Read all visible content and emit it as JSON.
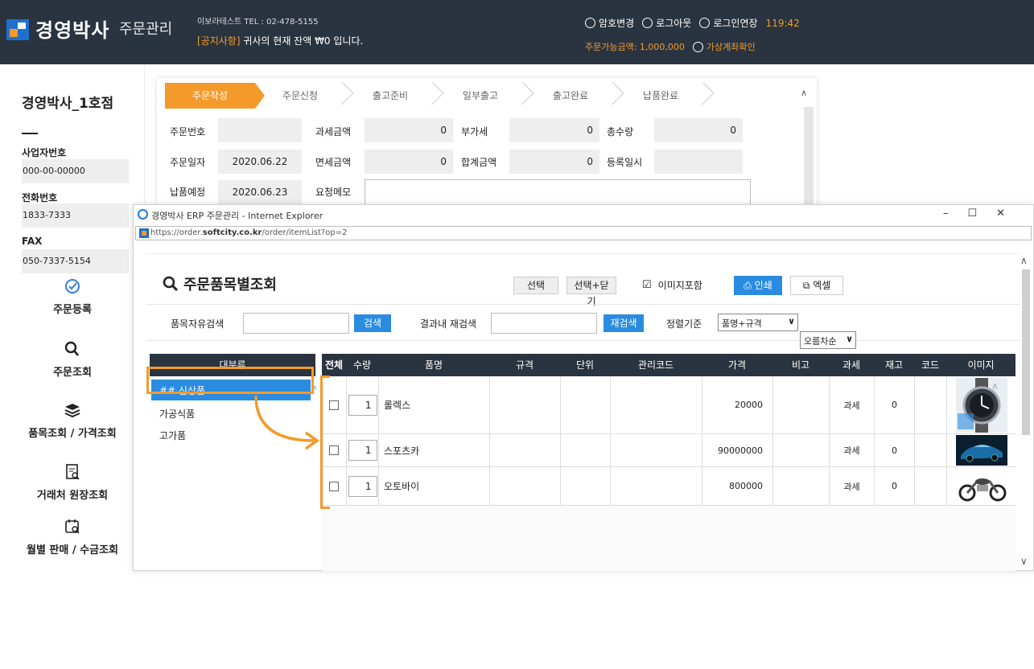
{
  "header": {
    "logo_text": "경영박사",
    "logo_sub": "주문관리",
    "company_info": "이보라테스트 TEL : 02-478-5155",
    "notice_tag": "[공지사항]",
    "notice_text": " 귀사의 현재 잔액 ₩0 입니다.",
    "password_change": "암호변경",
    "logout": "로그아웃",
    "extend_login": "로그인연장",
    "timer": "119:42",
    "order_limit": "주문가능금액: 1,000,000",
    "virtual_account": "가상계좌확인"
  },
  "sidebar": {
    "store_name": "경영박사_1호점",
    "biz_label": "사업자번호",
    "biz_value": "000-00-00000",
    "phone_label": "전화번호",
    "phone_value": "1833-7333",
    "fax_label": "FAX",
    "fax_value": "050-7337-5154",
    "menu": [
      {
        "label": "주문등록",
        "icon": "check-circle-icon"
      },
      {
        "label": "주문조회",
        "icon": "search-icon"
      },
      {
        "label": "품목조회 / 가격조회",
        "icon": "layers-icon"
      },
      {
        "label": "거래처 원장조회",
        "icon": "ledger-search-icon"
      },
      {
        "label": "월별 판매 / 수금조회",
        "icon": "calendar-search-icon"
      }
    ]
  },
  "order_form": {
    "steps": [
      "주문작성",
      "주문신청",
      "출고준비",
      "일부출고",
      "출고완료",
      "납품완료"
    ],
    "order_no_label": "주문번호",
    "order_no_value": "",
    "taxable_label": "과세금액",
    "taxable_value": "0",
    "vat_label": "부가세",
    "vat_value": "0",
    "total_qty_label": "총수량",
    "total_qty_value": "0",
    "order_date_label": "주문일자",
    "order_date_value": "2020.06.22",
    "taxfree_label": "면세금액",
    "taxfree_value": "0",
    "sum_label": "합계금액",
    "sum_value": "0",
    "reg_date_label": "등록일시",
    "reg_date_value": "",
    "delivery_label": "납품예정",
    "delivery_value": "2020.06.23",
    "memo_label": "요청메모"
  },
  "popup": {
    "window_title": "경영박사 ERP 주문관리 - Internet Explorer",
    "url_prefix": "https://order.",
    "url_domain": "softcity.co.kr",
    "url_path": "/order/itemList?op=2",
    "title": "주문품목별조회",
    "btn_select": "선택",
    "btn_select_close": "선택+닫기",
    "include_image": "이미지포함",
    "btn_print": "인쇄",
    "btn_excel": "엑셀",
    "free_search_label": "품목자유검색",
    "free_search_value": "",
    "btn_search": "검색",
    "result_search_label": "결과내 재검색",
    "result_search_value": "",
    "btn_research": "재검색",
    "sort_label": "정렬기준",
    "sort_value": "품명+규격",
    "order_value": "오름차순",
    "category_header": "대분류",
    "categories": [
      "## 신상품",
      "가공식품",
      "고가품"
    ],
    "columns": [
      "전체",
      "수량",
      "품명",
      "규격",
      "단위",
      "관리코드",
      "가격",
      "비고",
      "과세",
      "재고",
      "코드",
      "이미지"
    ],
    "rows": [
      {
        "qty": "1",
        "name": "롤렉스",
        "spec": "",
        "unit": "",
        "mgmt": "",
        "price": "20000",
        "note": "",
        "tax": "과세",
        "stock": "0",
        "code": "",
        "image": "watch"
      },
      {
        "qty": "1",
        "name": "스포츠카",
        "spec": "",
        "unit": "",
        "mgmt": "",
        "price": "90000000",
        "note": "",
        "tax": "과세",
        "stock": "0",
        "code": "",
        "image": "sports-car"
      },
      {
        "qty": "1",
        "name": "오토바이",
        "spec": "",
        "unit": "",
        "mgmt": "",
        "price": "800000",
        "note": "",
        "tax": "과세",
        "stock": "0",
        "code": "",
        "image": "motorcycle"
      }
    ]
  },
  "colors": {
    "header_bg": "#2a3440",
    "accent_orange": "#f39a2b",
    "button_blue": "#2a8ce0"
  }
}
